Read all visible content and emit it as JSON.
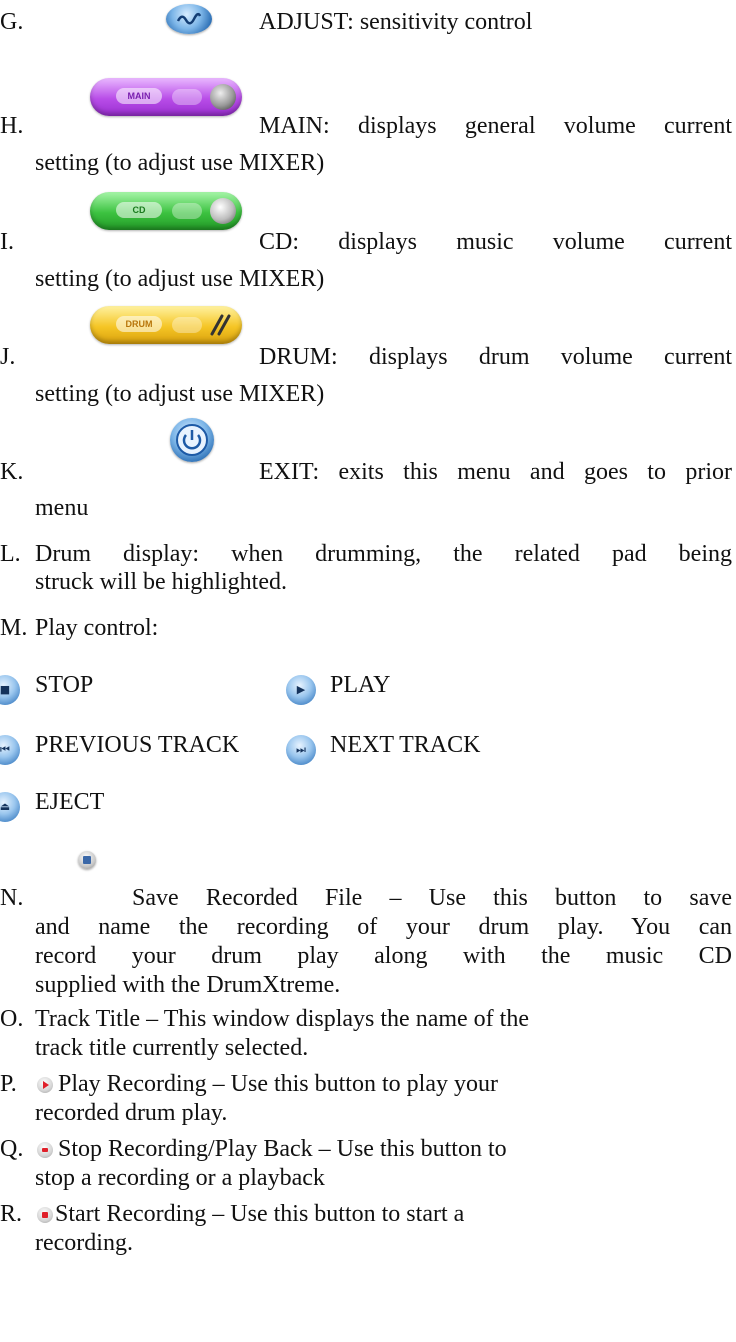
{
  "items": {
    "g": {
      "letter": "G.",
      "text": "ADJUST: sensitivity control",
      "icon": "adjust-icon"
    },
    "h": {
      "letter": "H.",
      "line1": "MAIN: displays general volume current",
      "line2": "setting (to adjust use MIXER)",
      "pill_label": "MAIN",
      "icon": "main-volume-slider"
    },
    "i": {
      "letter": "I.",
      "line1": "CD:   displays music volume current",
      "line2": "setting (to adjust use MIXER)",
      "pill_label": "CD",
      "icon": "cd-volume-slider"
    },
    "j": {
      "letter": "J.",
      "line1": "DRUM: displays drum volume current",
      "line2": "setting (to adjust use MIXER)",
      "pill_label": "DRUM",
      "icon": "drum-volume-slider"
    },
    "k": {
      "letter": "K.",
      "line1": "EXIT: exits this menu and goes to prior",
      "line2": "menu",
      "icon": "power-icon"
    },
    "l": {
      "letter": "L.",
      "line1": "Drum display: when drumming, the related pad being",
      "line2": "struck will be highlighted."
    },
    "m": {
      "letter": "M.",
      "text": "Play control:"
    },
    "n": {
      "letter": "N.",
      "line1": "Save Recorded File – Use this button to save",
      "line2": "and name the recording of your drum play. You can",
      "line3": "record your drum play along with the music CD",
      "line4": "supplied with the DrumXtreme."
    },
    "o": {
      "letter": "O.",
      "line1": "Track Title – This window displays the name of the",
      "line2": "track title currently selected."
    },
    "p": {
      "letter": "P.",
      "line1": "Play Recording – Use this button to play your",
      "line2": "recorded drum play."
    },
    "q": {
      "letter": "Q.",
      "line1": "Stop Recording/Play Back – Use this button to",
      "line2": "stop a recording or a playback"
    },
    "r": {
      "letter": "R.",
      "line1": "Start Recording – Use this button to start a",
      "line2": "recording."
    }
  },
  "play_controls": {
    "stop": "STOP",
    "play": "PLAY",
    "previous": "PREVIOUS TRACK",
    "next": "NEXT TRACK",
    "eject": "EJECT"
  }
}
